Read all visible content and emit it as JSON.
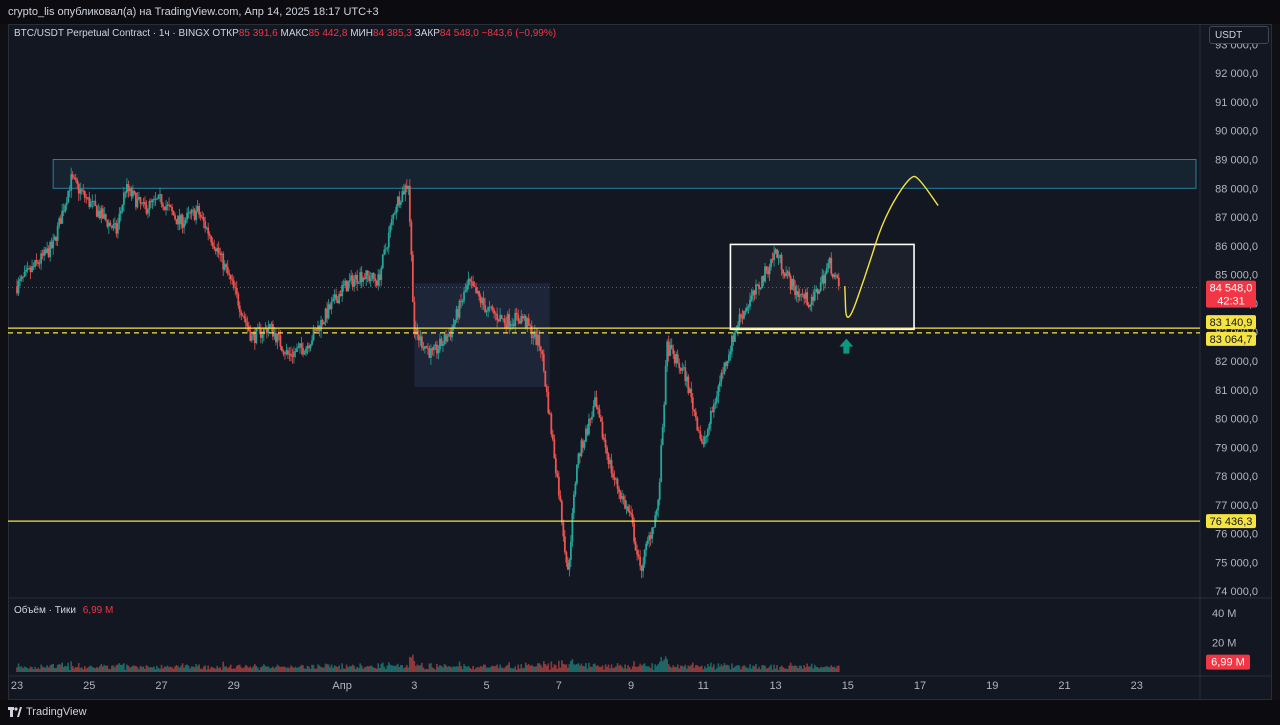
{
  "header": {
    "publish_line": "crypto_lis опубликовал(а) на TradingView.com, Апр 14, 2025 18:17 UTC+3"
  },
  "legend": {
    "symbol": "BTC/USDT Perpetual Contract · 1ч · BINGX",
    "open_label": "ОТКР",
    "open_value": "85 391,6",
    "high_label": "МАКС",
    "high_value": "85 442,8",
    "low_label": "МИН",
    "low_value": "84 385,3",
    "close_label": "ЗАКР",
    "close_value": "84 548,0",
    "change": "−843,6 (−0,99%)"
  },
  "currency_button": "USDT",
  "volume_legend": {
    "label": "Объём · Тики",
    "value": "6,99 M"
  },
  "footer": {
    "brand": "TradingView"
  },
  "colors": {
    "up": "#26a69a",
    "down": "#ef5350",
    "zone": "#2e7d9a",
    "level": "#f5e342",
    "box": "#ffffff",
    "projection": "#f5e342",
    "arrow": "#089981"
  },
  "chart_data": {
    "type": "candlestick",
    "ylim": [
      73800,
      93500
    ],
    "y_ticks": [
      "74 000,0",
      "75 000,0",
      "76 000,0",
      "77 000,0",
      "78 000,0",
      "79 000,0",
      "80 000,0",
      "81 000,0",
      "82 000,0",
      "83 000,0",
      "84 000,0",
      "85 000,0",
      "86 000,0",
      "87 000,0",
      "88 000,0",
      "89 000,0",
      "90 000,0",
      "91 000,0",
      "92 000,0",
      "93 000,0"
    ],
    "y_tick_values": [
      74000,
      75000,
      76000,
      77000,
      78000,
      79000,
      80000,
      81000,
      82000,
      83000,
      84000,
      85000,
      86000,
      87000,
      88000,
      89000,
      90000,
      91000,
      92000,
      93000
    ],
    "x_ticks": [
      "23",
      "25",
      "27",
      "29",
      "Апр",
      "3",
      "5",
      "7",
      "9",
      "11",
      "13",
      "15",
      "17",
      "19",
      "21",
      "23"
    ],
    "x_tick_values": [
      "2025-03-23",
      "2025-03-25",
      "2025-03-27",
      "2025-03-29",
      "2025-04-01",
      "2025-04-03",
      "2025-04-05",
      "2025-04-07",
      "2025-04-09",
      "2025-04-11",
      "2025-04-13",
      "2025-04-15",
      "2025-04-17",
      "2025-04-19",
      "2025-04-21",
      "2025-04-23"
    ],
    "price_path": [
      [
        "2025-03-23",
        84600
      ],
      [
        "2025-03-24",
        86000
      ],
      [
        "2025-03-24T12",
        88300
      ],
      [
        "2025-03-25",
        87500
      ],
      [
        "2025-03-25T18",
        86500
      ],
      [
        "2025-03-26",
        88000
      ],
      [
        "2025-03-26T12",
        87300
      ],
      [
        "2025-03-27",
        87600
      ],
      [
        "2025-03-27T12",
        86800
      ],
      [
        "2025-03-28",
        87200
      ],
      [
        "2025-03-28T12",
        86000
      ],
      [
        "2025-03-29",
        84500
      ],
      [
        "2025-03-29T12",
        82800
      ],
      [
        "2025-03-30",
        83200
      ],
      [
        "2025-03-30T12",
        82200
      ],
      [
        "2025-03-31",
        82500
      ],
      [
        "2025-03-31T12",
        83500
      ],
      [
        "2025-04-01",
        84500
      ],
      [
        "2025-04-01T12",
        85000
      ],
      [
        "2025-04-02",
        84800
      ],
      [
        "2025-04-02T12",
        87500
      ],
      [
        "2025-04-02T20",
        88200
      ],
      [
        "2025-04-03",
        83000
      ],
      [
        "2025-04-03T12",
        82200
      ],
      [
        "2025-04-04",
        83000
      ],
      [
        "2025-04-04T12",
        84700
      ],
      [
        "2025-04-05",
        83800
      ],
      [
        "2025-04-05T12",
        83400
      ],
      [
        "2025-04-06",
        83500
      ],
      [
        "2025-04-06T12",
        82500
      ],
      [
        "2025-04-07",
        77500
      ],
      [
        "2025-04-07T06",
        74600
      ],
      [
        "2025-04-07T12",
        78500
      ],
      [
        "2025-04-08",
        80500
      ],
      [
        "2025-04-08T12",
        78000
      ],
      [
        "2025-04-09",
        76500
      ],
      [
        "2025-04-09T06",
        74700
      ],
      [
        "2025-04-09T18",
        77000
      ],
      [
        "2025-04-10",
        82500
      ],
      [
        "2025-04-10T12",
        81500
      ],
      [
        "2025-04-11",
        79000
      ],
      [
        "2025-04-11T12",
        81500
      ],
      [
        "2025-04-12",
        83500
      ],
      [
        "2025-04-12T12",
        84500
      ],
      [
        "2025-04-13",
        85800
      ],
      [
        "2025-04-13T12",
        84500
      ],
      [
        "2025-04-14",
        84000
      ],
      [
        "2025-04-14T12",
        85400
      ],
      [
        "2025-04-14T18",
        84548
      ]
    ],
    "resistance_zone": {
      "y_low": 88000,
      "y_high": 89000,
      "x_start": "2025-03-24"
    },
    "range_box": {
      "x_start": "2025-04-11T18",
      "x_end": "2025-04-16T20",
      "y_low": 83100,
      "y_high": 86050
    },
    "profile_box": {
      "x_start": "2025-04-03",
      "x_end": "2025-04-06T18",
      "y_low": 81100,
      "y_high": 84700
    },
    "levels": [
      {
        "value": 83140.9,
        "label": "83 140,9",
        "style": "solid"
      },
      {
        "value": 83064.7,
        "label": "83 064,7",
        "style": "dashed"
      },
      {
        "value": 76436.3,
        "label": "76 436,3",
        "style": "solid"
      }
    ],
    "last_price": {
      "value": 84548.0,
      "label": "84 548,0",
      "countdown": "42:31"
    },
    "projection": [
      [
        "2025-04-14T22",
        84600
      ],
      [
        "2025-04-14T23",
        83100
      ],
      [
        "2025-04-15T12",
        85000
      ],
      [
        "2025-04-16",
        87000
      ],
      [
        "2025-04-16T18",
        88500
      ],
      [
        "2025-04-17",
        88300
      ],
      [
        "2025-04-17T12",
        87400
      ]
    ],
    "arrow": {
      "x": "2025-04-14T23",
      "y": 82500,
      "direction": "up"
    },
    "volume": {
      "y_ticks": [
        "20 M",
        "40 M"
      ],
      "y_tick_values": [
        20000000,
        40000000
      ],
      "last_label": "6,99 M",
      "last_value": 6990000
    }
  }
}
